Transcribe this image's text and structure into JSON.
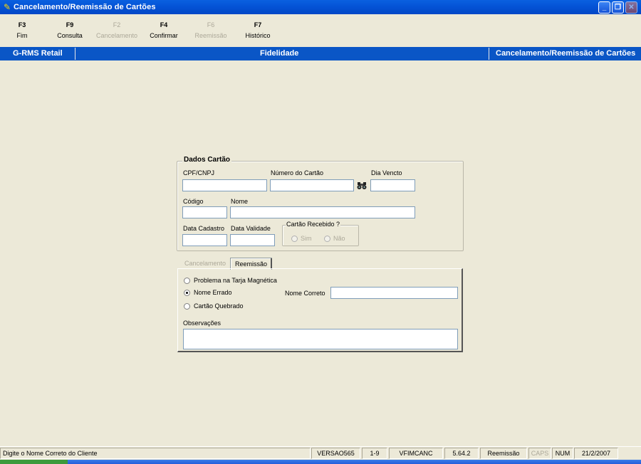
{
  "window": {
    "title": "Cancelamento/Reemissão de Cartões",
    "icon": "app-icon",
    "controls": [
      "minimize-icon",
      "restore-icon",
      "close-icon"
    ]
  },
  "fkeys": [
    {
      "key": "F3",
      "label": "Fim",
      "enabled": true
    },
    {
      "key": "F9",
      "label": "Consulta",
      "enabled": true
    },
    {
      "key": "F2",
      "label": "Cancelamento",
      "enabled": false
    },
    {
      "key": "F4",
      "label": "Confirmar",
      "enabled": true
    },
    {
      "key": "F6",
      "label": "Reemissão",
      "enabled": false
    },
    {
      "key": "F7",
      "label": "Histórico",
      "enabled": true
    }
  ],
  "header": {
    "left": "G-RMS Retail",
    "center": "Fidelidade",
    "right": "Cancelamento/Reemissão de Cartões"
  },
  "dados_cartao": {
    "legend": "Dados Cartão",
    "cpf_label": "CPF/CNPJ",
    "cpf_value": "",
    "numero_label": "Número do Cartão",
    "numero_value": "",
    "binoculars_icon": "binoculars-icon",
    "dia_label": "Dia Vencto",
    "dia_value": "",
    "codigo_label": "Código",
    "codigo_value": "",
    "nome_label": "Nome",
    "nome_value": "",
    "data_cadastro_label": "Data Cadastro",
    "data_cadastro_value": "",
    "data_validade_label": "Data Validade",
    "data_validade_value": "",
    "recebido": {
      "legend": "Cartão Recebido ?",
      "sim": "Sim",
      "nao": "Não"
    }
  },
  "tabs": [
    {
      "label": "Cancelamento",
      "active": false
    },
    {
      "label": "Reemissão",
      "active": true
    }
  ],
  "reemissao": {
    "options": [
      {
        "label": "Problema na Tarja Magnética",
        "checked": false
      },
      {
        "label": "Nome Errado",
        "checked": true
      },
      {
        "label": "Cartão Quebrado",
        "checked": false
      }
    ],
    "nome_correto_label": "Nome Correto",
    "nome_correto_value": "",
    "observacoes_label": "Observações",
    "observacoes_value": ""
  },
  "statusbar": {
    "message": "Digite o Nome Correto do Cliente",
    "version": "VERSAO565",
    "page": "1-9",
    "program": "VFIMCANC",
    "build": "5.64.2",
    "mode": "Reemissão",
    "caps": "CAPS",
    "num": "NUM",
    "date": "21/2/2007"
  },
  "colors": {
    "title_bar": "#0453d6",
    "header_band": "#0a56c6",
    "window_bg": "#ece9d8",
    "disabled_text": "#aca899"
  }
}
